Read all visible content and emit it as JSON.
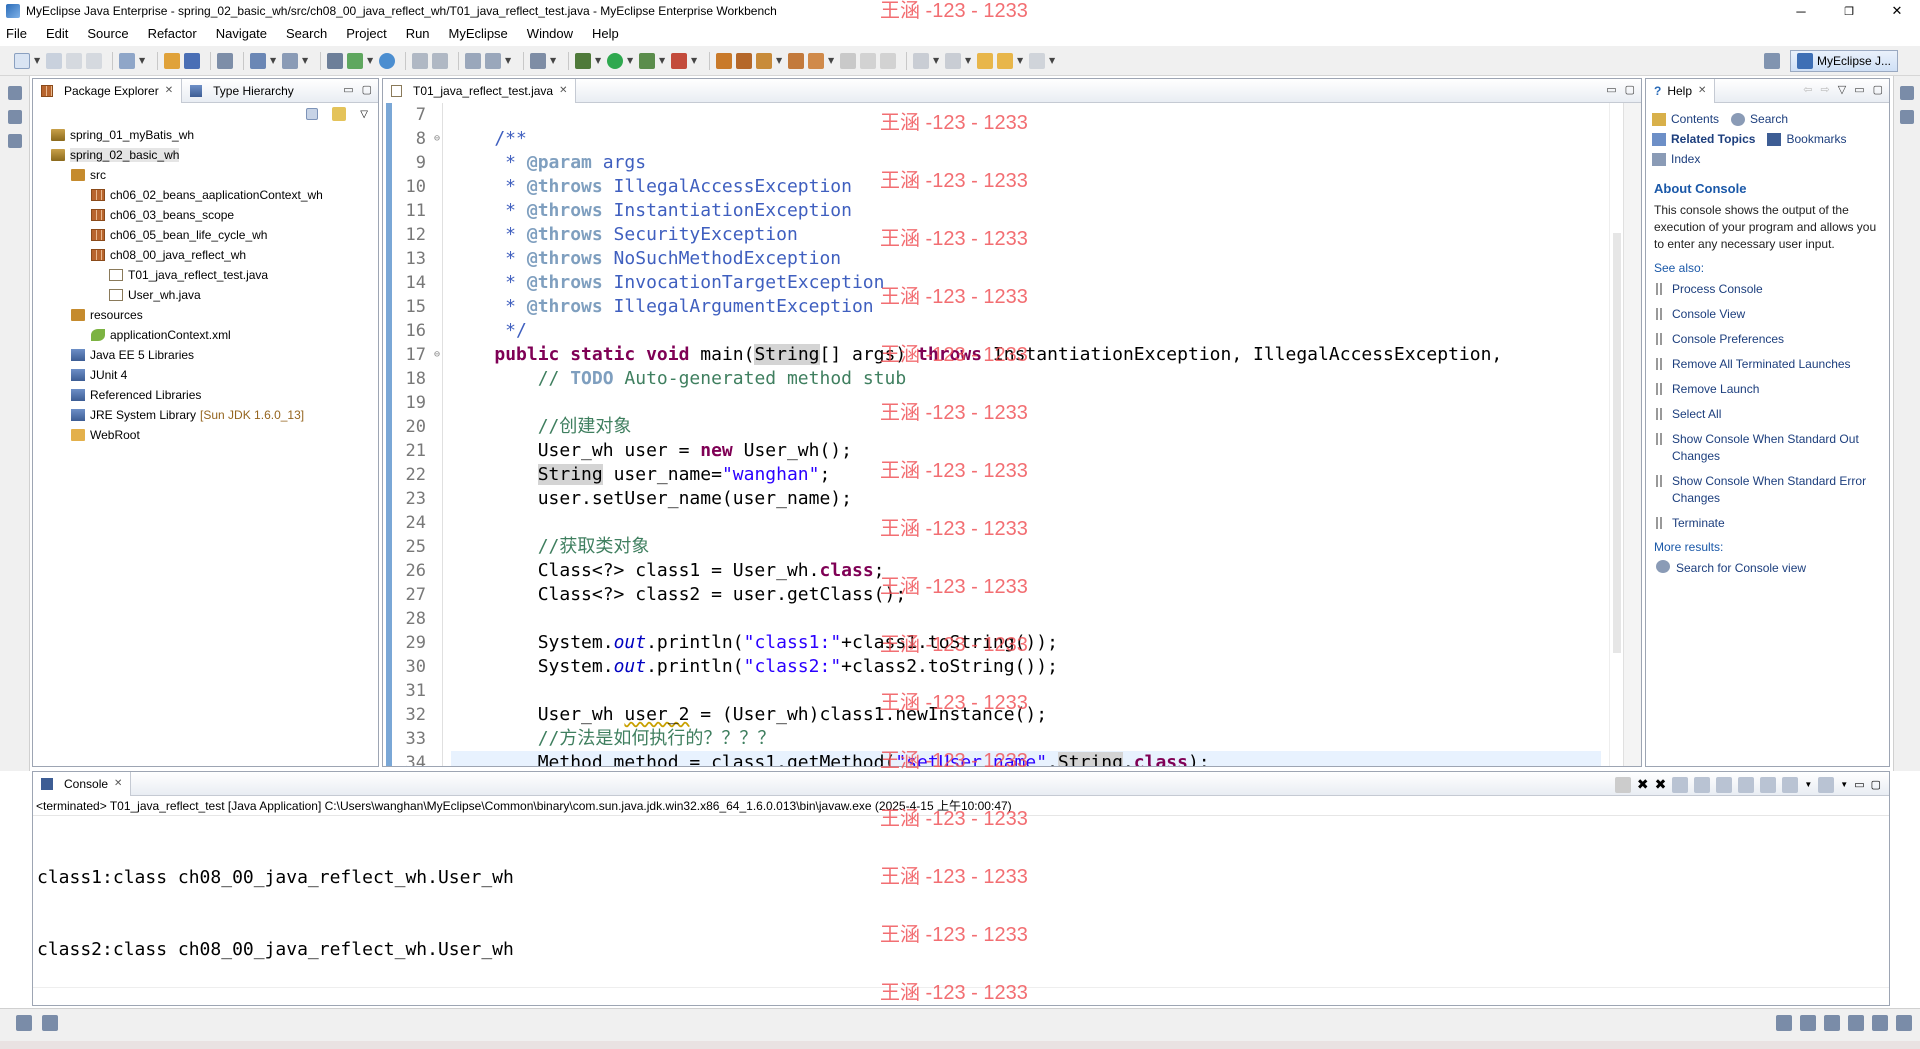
{
  "window": {
    "title": "MyEclipse Java Enterprise - spring_02_basic_wh/src/ch08_00_java_reflect_wh/T01_java_reflect_test.java - MyEclipse Enterprise Workbench",
    "minimize": "─",
    "maximize": "❐",
    "close": "✕"
  },
  "menu": [
    "File",
    "Edit",
    "Source",
    "Refactor",
    "Navigate",
    "Search",
    "Project",
    "Run",
    "MyEclipse",
    "Window",
    "Help"
  ],
  "perspective": {
    "label": "MyEclipse J..."
  },
  "package_explorer": {
    "tabs": [
      {
        "label": "Package Explorer"
      },
      {
        "label": "Type Hierarchy"
      }
    ],
    "tree": [
      {
        "label": "spring_01_myBatis_wh",
        "icon": "project-icon",
        "depth": 0,
        "extra": ""
      },
      {
        "label": "spring_02_basic_wh",
        "icon": "project-icon",
        "depth": 0,
        "extra": "",
        "selected": true
      },
      {
        "label": "src",
        "icon": "source-folder-icon",
        "depth": 1,
        "extra": ""
      },
      {
        "label": "ch06_02_beans_aaplicationContext_wh",
        "icon": "package-icon",
        "depth": 2,
        "extra": ""
      },
      {
        "label": "ch06_03_beans_scope",
        "icon": "package-icon",
        "depth": 2,
        "extra": ""
      },
      {
        "label": "ch06_05_bean_life_cycle_wh",
        "icon": "package-icon",
        "depth": 2,
        "extra": ""
      },
      {
        "label": "ch08_00_java_reflect_wh",
        "icon": "package-icon",
        "depth": 2,
        "extra": ""
      },
      {
        "label": "T01_java_reflect_test.java",
        "icon": "java-file-icon",
        "depth": 3,
        "extra": ""
      },
      {
        "label": "User_wh.java",
        "icon": "java-file-icon",
        "depth": 3,
        "extra": ""
      },
      {
        "label": "resources",
        "icon": "source-folder-icon",
        "depth": 1,
        "extra": ""
      },
      {
        "label": "applicationContext.xml",
        "icon": "xml-file-icon",
        "depth": 2,
        "extra": ""
      },
      {
        "label": "Java EE 5 Libraries",
        "icon": "library-icon",
        "depth": 1,
        "extra": ""
      },
      {
        "label": "JUnit 4",
        "icon": "library-icon",
        "depth": 1,
        "extra": ""
      },
      {
        "label": "Referenced Libraries",
        "icon": "library-icon",
        "depth": 1,
        "extra": ""
      },
      {
        "label": "JRE System Library",
        "icon": "library-icon",
        "depth": 1,
        "extra": "[Sun JDK 1.6.0_13]"
      },
      {
        "label": "WebRoot",
        "icon": "folder-icon",
        "depth": 1,
        "extra": ""
      }
    ]
  },
  "editor": {
    "tab": "T01_java_reflect_test.java",
    "line_numbers": [
      "7",
      "8",
      "9",
      "10",
      "11",
      "12",
      "13",
      "14",
      "15",
      "16",
      "17",
      "18",
      "19",
      "20",
      "21",
      "22",
      "23",
      "24",
      "25",
      "26",
      "27",
      "28",
      "29",
      "30",
      "31",
      "32",
      "33",
      "34"
    ],
    "current_line": "34"
  },
  "help": {
    "tab": "Help",
    "nav": {
      "contents": "Contents",
      "search": "Search",
      "related": "Related Topics",
      "bookmarks": "Bookmarks",
      "index": "Index"
    },
    "about_title": "About Console",
    "about_text": "This console shows the output of the execution of your program and allows you to enter any necessary user input.",
    "see_also": "See also:",
    "links": [
      "Process Console",
      "Console View",
      "Console Preferences",
      "Remove All Terminated Launches",
      "Remove Launch",
      "Select All",
      "Show Console When Standard Out Changes",
      "Show Console When Standard Error Changes",
      "Terminate"
    ],
    "more_results": "More results:",
    "search_link": "Search for Console view"
  },
  "console": {
    "tab": "Console",
    "info": "<terminated> T01_java_reflect_test [Java Application] C:\\Users\\wanghan\\MyEclipse\\Common\\binary\\com.sun.java.jdk.win32.x86_64_1.6.0.013\\bin\\javaw.exe (2025-4-15 上午10:00:47)",
    "output": [
      "class1:class ch08_00_java_reflect_wh.User_wh",
      "class2:class ch08_00_java_reflect_wh.User_wh"
    ]
  },
  "watermark": "王涵 -123 - 1233"
}
